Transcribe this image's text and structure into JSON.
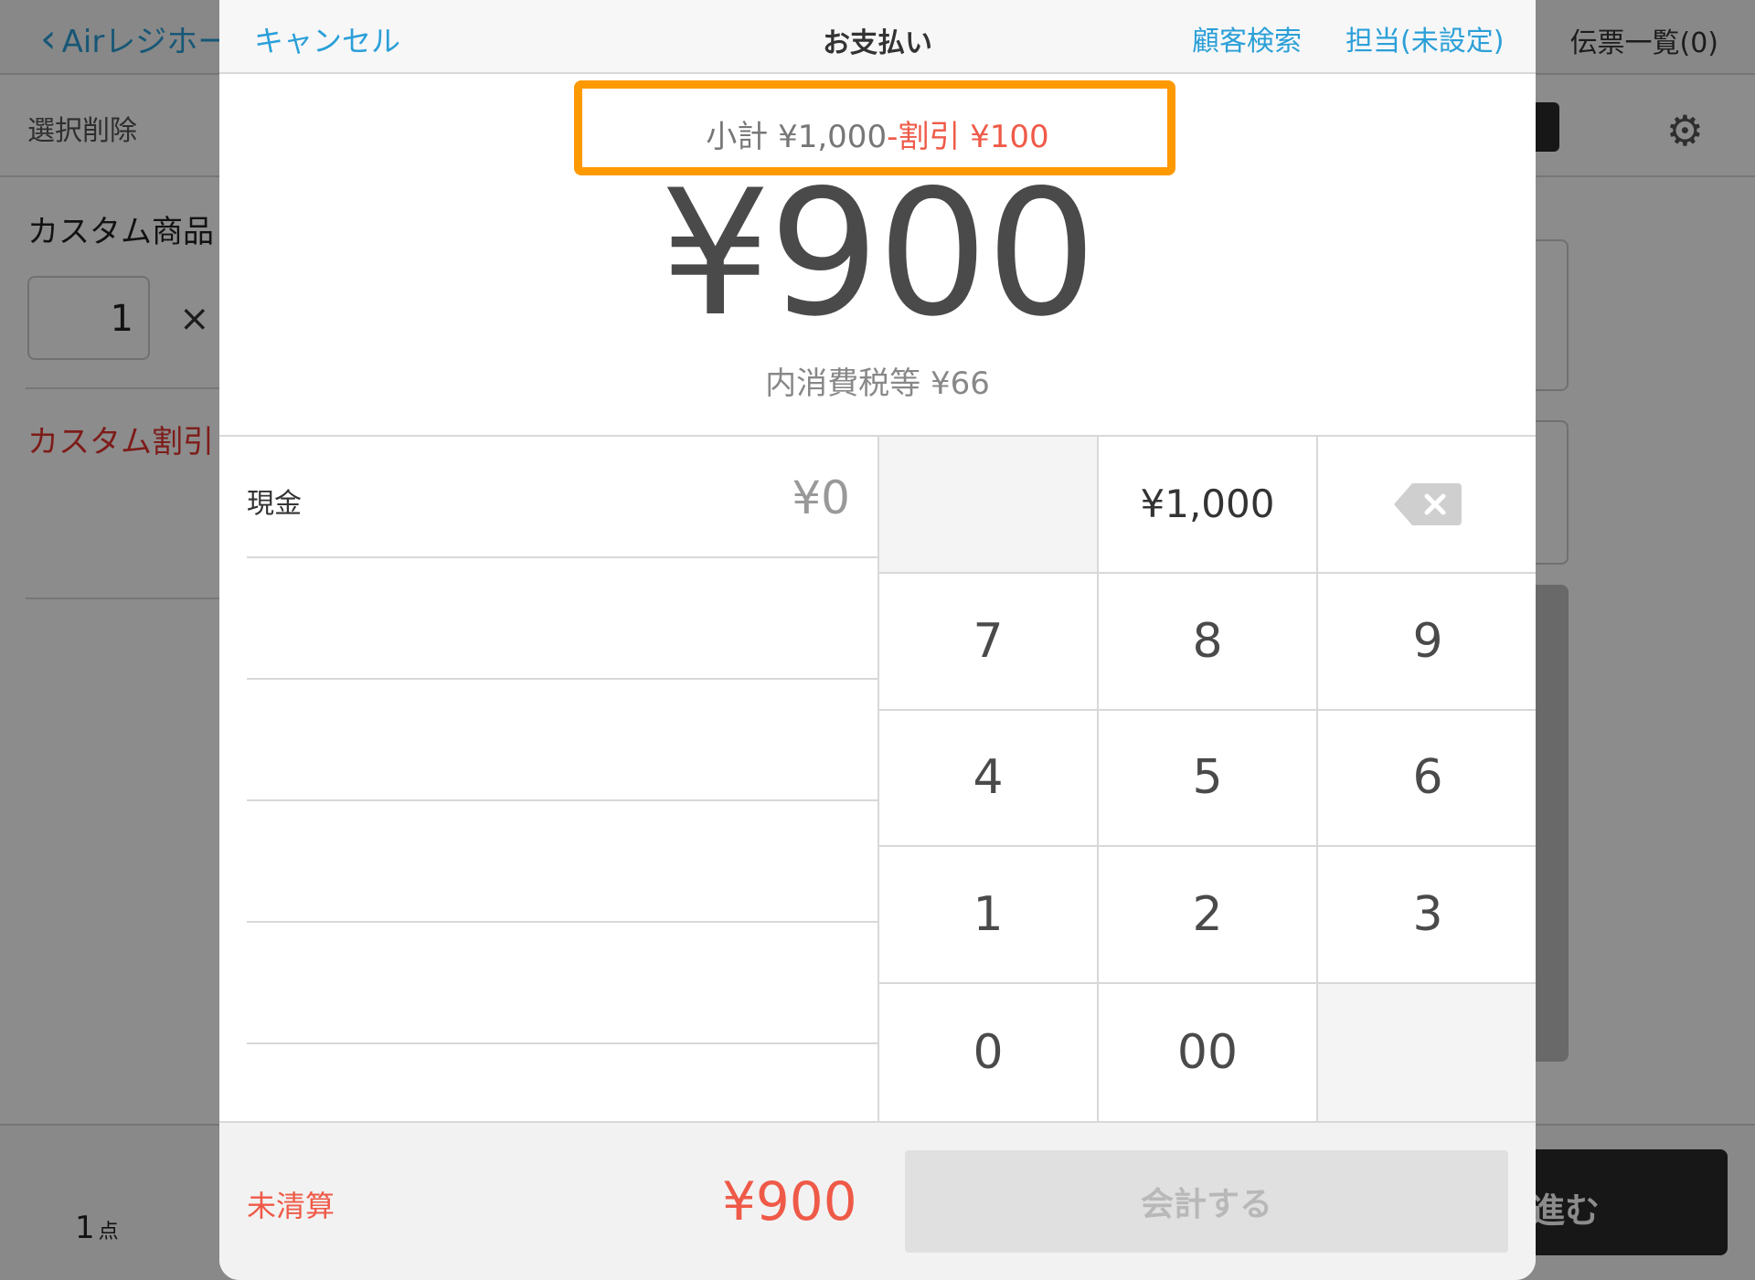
{
  "background": {
    "back_label": "Airレジホー",
    "slips_label": "伝票一覧(0)",
    "delete_label": "選択削除",
    "product_label": "カスタム商品",
    "quantity": "1",
    "times_sign": "×",
    "discount_label": "カスタム割引",
    "item_count": "1",
    "item_count_unit": "点",
    "next_label": "進む"
  },
  "modal": {
    "cancel_label": "キャンセル",
    "title": "お支払い",
    "customer_search_label": "顧客検索",
    "staff_label": "担当(未設定)",
    "subtotal_text": "小計 ¥1,000",
    "discount_text": "-割引 ¥100",
    "total": "¥900",
    "tax_text": "内消費税等 ¥66",
    "payments": [
      {
        "label": "現金",
        "amount": "¥0"
      },
      {
        "label": "",
        "amount": ""
      },
      {
        "label": "",
        "amount": ""
      },
      {
        "label": "",
        "amount": ""
      },
      {
        "label": "",
        "amount": ""
      }
    ],
    "keypad": {
      "preset": "¥1,000",
      "keys": [
        "7",
        "8",
        "9",
        "4",
        "5",
        "6",
        "1",
        "2",
        "3",
        "0",
        "00"
      ]
    },
    "footer": {
      "status": "未清算",
      "total": "¥900",
      "checkout_label": "会計する"
    }
  },
  "colors": {
    "accent_blue": "#2a9fd8",
    "alert_red": "#ef5a48",
    "highlight_orange": "#ff9900"
  }
}
